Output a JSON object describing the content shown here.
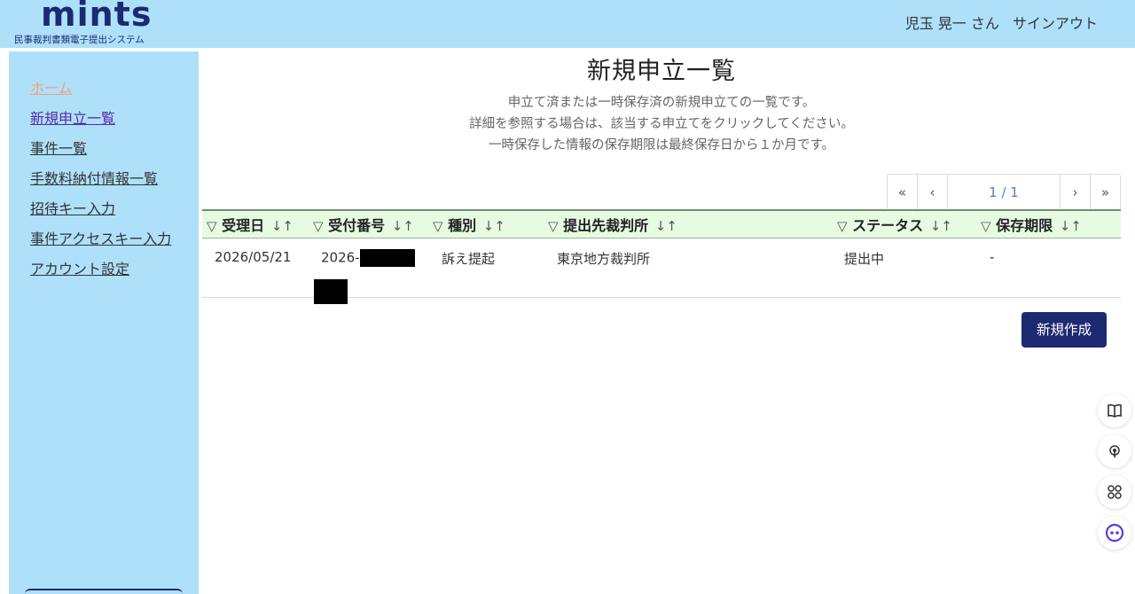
{
  "header": {
    "logo_text": "mints",
    "logo_subtitle": "民事裁判書類電子提出システム",
    "user_name": "児玉 晃一 さん",
    "signout_label": "サインアウト"
  },
  "sidebar": {
    "items": [
      {
        "label": "ホーム"
      },
      {
        "label": "新規申立一覧"
      },
      {
        "label": "事件一覧"
      },
      {
        "label": "手数料納付情報一覧"
      },
      {
        "label": "招待キー入力"
      },
      {
        "label": "事件アクセスキー入力"
      },
      {
        "label": "アカウント設定"
      }
    ]
  },
  "main": {
    "title": "新規申立一覧",
    "description": [
      "申立て済または一時保存済の新規申立ての一覧です。",
      "詳細を参照する場合は、該当する申立てをクリックしてください。",
      "一時保存した情報の保存期限は最終保存日から１か月です。"
    ],
    "pager": {
      "first": "«",
      "prev": "‹",
      "current": "1 / 1",
      "next": "›",
      "last": "»"
    },
    "table": {
      "columns": [
        "受理日",
        "受付番号",
        "種別",
        "提出先裁判所",
        "ステータス",
        "保存期限"
      ],
      "rows": [
        {
          "received_date": "2026/05/21",
          "receipt_number_visible": "2026-",
          "type": "訴え提起",
          "court": "東京地方裁判所",
          "status": "提出中",
          "expiry": "-"
        }
      ]
    },
    "new_button_label": "新規作成"
  },
  "icons": {
    "filter": "▽",
    "sort": "↓↑",
    "tools": [
      "book-icon",
      "broadcast-icon",
      "grid-icon",
      "face-icon"
    ]
  },
  "colors": {
    "header_bg": "#aee0fa",
    "brand": "#1c2a72",
    "table_header_bg": "#e6fbe2"
  }
}
